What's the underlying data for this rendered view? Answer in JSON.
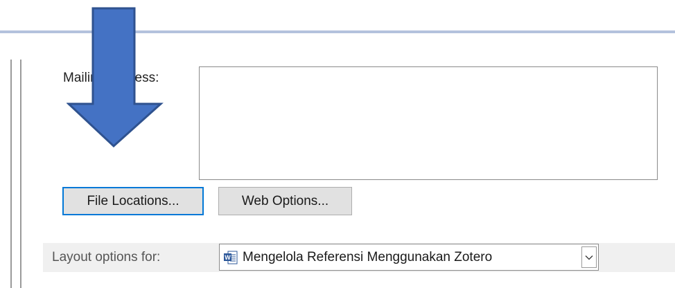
{
  "mail": {
    "label": "Mailing address:",
    "value": ""
  },
  "buttons": {
    "file_locations": "File Locations...",
    "web_options": "Web Options..."
  },
  "layout": {
    "label": "Layout options for:",
    "document": "Mengelola Referensi Menggunakan Zotero",
    "doc_icon": "word-document-icon",
    "dropdown_icon": "chevron-down-icon"
  },
  "annotation": {
    "icon": "down-arrow-icon",
    "color": "#4472c4",
    "outline": "#2f528f"
  },
  "colors": {
    "focus_border": "#0078d7",
    "button_bg": "#e1e1e1",
    "header_rule": "#b4c2dd"
  }
}
